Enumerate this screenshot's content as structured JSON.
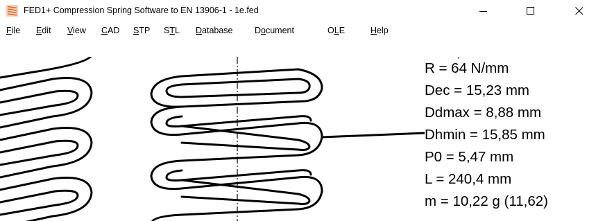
{
  "window": {
    "title": "FED1+  Compression Spring Software to EN 13906-1  -  1e.fed",
    "app_icon": "spring-app-icon",
    "buttons": [
      "minimize-icon",
      "maximize-icon",
      "close-icon"
    ]
  },
  "menu": {
    "items": [
      {
        "pre": "",
        "key": "F",
        "post": "ile"
      },
      {
        "pre": "",
        "key": "E",
        "post": "dit"
      },
      {
        "pre": "",
        "key": "V",
        "post": "iew"
      },
      {
        "pre": "",
        "key": "C",
        "post": "AD"
      },
      {
        "pre": "",
        "key": "S",
        "post": "TP"
      },
      {
        "pre": "S",
        "key": "T",
        "post": "L"
      },
      {
        "pre": "",
        "key": "D",
        "post": "atabase"
      },
      {
        "pre": "D",
        "key": "o",
        "post": "cument"
      },
      {
        "pre": "O",
        "key": "L",
        "post": "E"
      },
      {
        "pre": "",
        "key": "H",
        "post": "elp"
      }
    ]
  },
  "results": [
    "R = 64 N/mm",
    "Dec = 15,23 mm",
    "Ddmax = 8,88 mm",
    "Dhmin = 15,85 mm",
    "P0 = 5,47 mm",
    "L = 240,4 mm",
    "m = 10,22 g (11,62)"
  ],
  "colors": {
    "background": "#ffffff",
    "line": "#000000",
    "icon_orange": "#e8662a"
  }
}
